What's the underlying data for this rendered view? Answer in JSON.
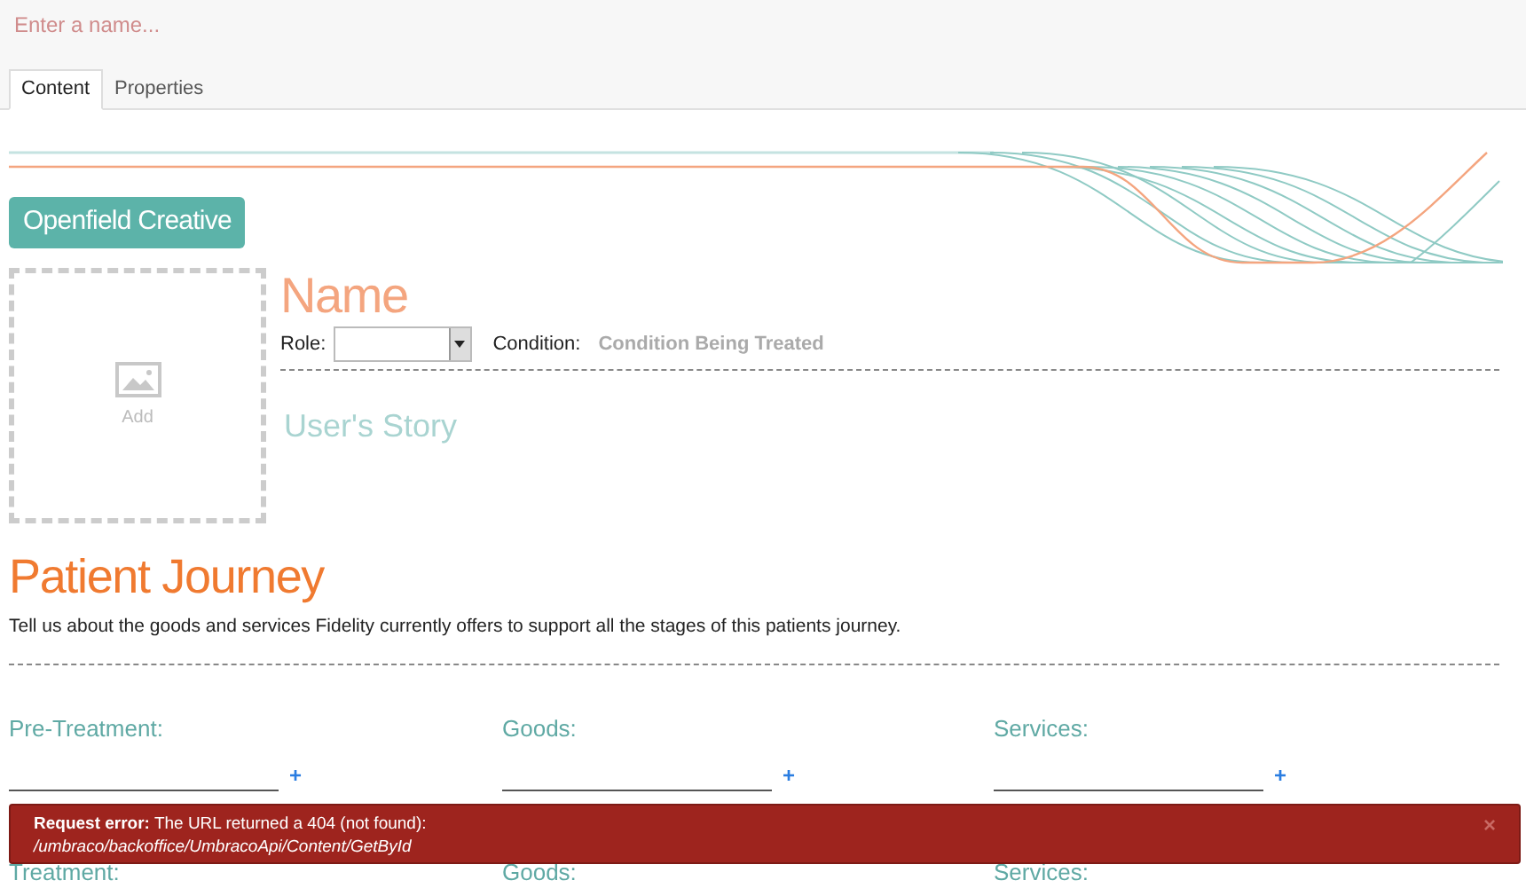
{
  "name_field": {
    "placeholder": "Enter a name..."
  },
  "tabs": [
    {
      "label": "Content",
      "selected": true
    },
    {
      "label": "Properties",
      "selected": false
    }
  ],
  "logo_button": "Openfield Creative",
  "image_upload": {
    "label": "Add"
  },
  "profile": {
    "name": "Name",
    "role_label": "Role:",
    "condition_label": "Condition:",
    "condition_placeholder": "Condition Being Treated",
    "story_placeholder": "User's Story"
  },
  "section": {
    "title": "Patient Journey",
    "description": "Tell us about the goods and services Fidelity currently offers to support all the stages of this patients journey."
  },
  "journey_rows": [
    {
      "fields": [
        {
          "label": "Pre-Treatment:",
          "add": "+"
        },
        {
          "label": "Goods:",
          "add": "+"
        },
        {
          "label": "Services:",
          "add": "+"
        }
      ]
    },
    {
      "fields": [
        {
          "label": "Treatment:"
        },
        {
          "label": "Goods:"
        },
        {
          "label": "Services:"
        }
      ]
    }
  ],
  "error": {
    "title": "Request error:",
    "message": "The URL returned a 404 (not found):",
    "url": "/umbraco/backoffice/UmbracoApi/Content/GetById",
    "close": "×"
  }
}
